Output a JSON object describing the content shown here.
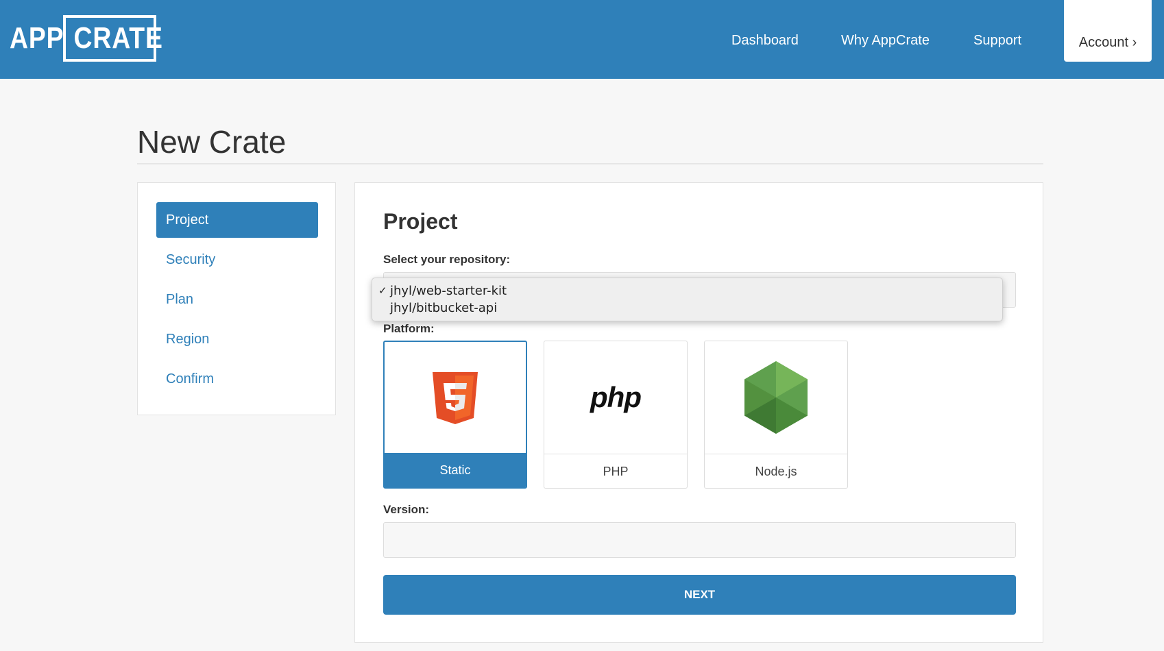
{
  "header": {
    "logo_app": "APP",
    "logo_crate": "CRATE",
    "nav": {
      "dashboard": "Dashboard",
      "why": "Why AppCrate",
      "support": "Support",
      "account": "Account ›"
    }
  },
  "page": {
    "title": "New Crate"
  },
  "sidebar": {
    "items": [
      {
        "label": "Project",
        "active": true
      },
      {
        "label": "Security"
      },
      {
        "label": "Plan"
      },
      {
        "label": "Region"
      },
      {
        "label": "Confirm"
      }
    ]
  },
  "form": {
    "title": "Project",
    "repo_label": "Select your repository:",
    "repo_options": [
      {
        "label": "jhyl/web-starter-kit",
        "checked": true
      },
      {
        "label": "jhyl/bitbucket-api"
      }
    ],
    "check_glyph": "✓",
    "platform_label": "Platform:",
    "platforms": [
      {
        "label": "Static",
        "icon": "html5-icon",
        "selected": true
      },
      {
        "label": "PHP",
        "icon": "php-logo",
        "logo_text": "php"
      },
      {
        "label": "Node.js",
        "icon": "nodejs-icon"
      }
    ],
    "version_label": "Version:",
    "version_value": "",
    "next_label": "NEXT"
  },
  "colors": {
    "brand": "#2f80b9",
    "html5": "#e44d26",
    "node": "#5fa04e"
  }
}
